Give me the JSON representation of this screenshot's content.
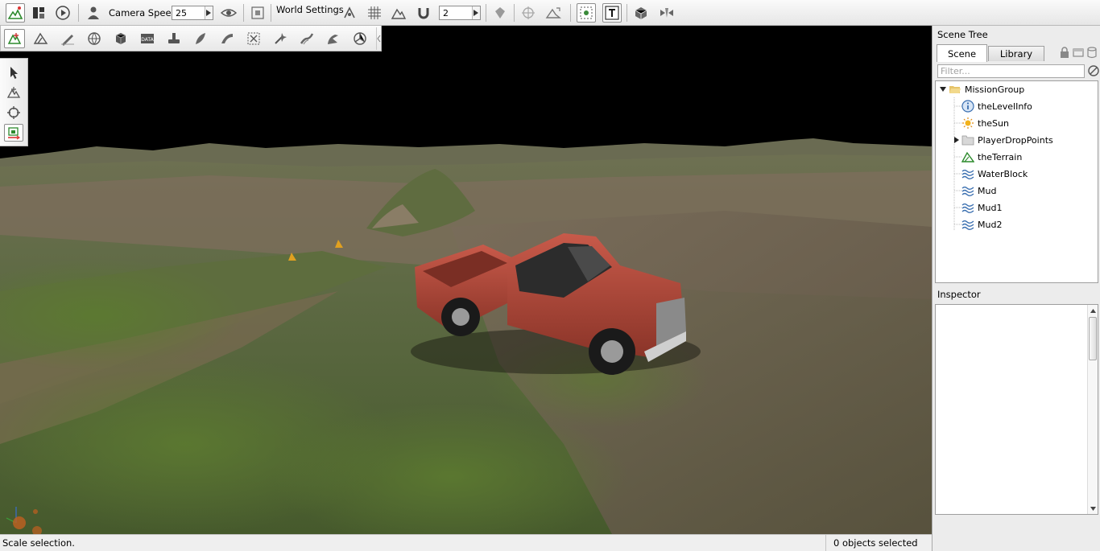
{
  "toolbar": {
    "camera_speed_label": "Camera Speed",
    "camera_speed_value": "25",
    "world_settings_label": "World Settings",
    "snap_value": "2"
  },
  "status": {
    "message": "Scale selection.",
    "selection": "0 objects selected"
  },
  "scene_tree": {
    "title": "Scene Tree",
    "tabs": [
      "Scene",
      "Library"
    ],
    "active_tab": "Scene",
    "filter_placeholder": "Filter...",
    "root": "MissionGroup",
    "items": [
      {
        "label": "theLevelInfo",
        "icon": "info-icon"
      },
      {
        "label": "theSun",
        "icon": "sun-icon"
      },
      {
        "label": "PlayerDropPoints",
        "icon": "folder-icon",
        "expandable": true
      },
      {
        "label": "theTerrain",
        "icon": "terrain-icon"
      },
      {
        "label": "WaterBlock",
        "icon": "water-icon"
      },
      {
        "label": "Mud",
        "icon": "water-icon"
      },
      {
        "label": "Mud1",
        "icon": "water-icon"
      },
      {
        "label": "Mud2",
        "icon": "water-icon"
      }
    ]
  },
  "inspector": {
    "title": "Inspector"
  },
  "colors": {
    "sky": "#000000",
    "grass": "#55643a",
    "dirt": "#6f6250",
    "truck_body": "#b04a3a",
    "water_icon": "#3a6fb0",
    "terrain_icon": "#2c8a2c"
  }
}
